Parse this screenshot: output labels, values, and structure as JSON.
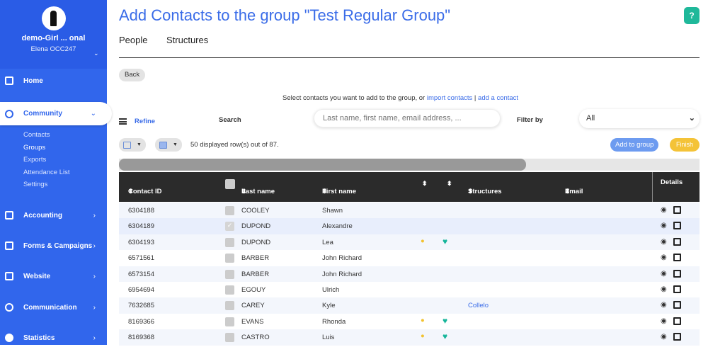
{
  "sidebar": {
    "org": "demo-Girl ... onal",
    "user": "Elena OCC247",
    "items": [
      {
        "label": "Home"
      },
      {
        "label": "Community"
      },
      {
        "label": "Accounting"
      },
      {
        "label": "Forms & Campaigns"
      },
      {
        "label": "Website"
      },
      {
        "label": "Communication"
      },
      {
        "label": "Statistics"
      }
    ],
    "sub": [
      "Contacts",
      "Groups",
      "Exports",
      "Attendance List",
      "Settings"
    ]
  },
  "header": {
    "title": "Add Contacts to the group \"Test Regular Group\"",
    "help": "?",
    "tabs": [
      "People",
      "Structures"
    ]
  },
  "toolbar": {
    "back": "Back",
    "hint": "Select contacts you want to add to the group, or",
    "import": "import contacts",
    "sep": " | ",
    "add_contact": "add a contact",
    "refine": "Refine",
    "search_label": "Search",
    "search_placeholder": "Last name, first name, email address, ...",
    "filter_label": "Filter by",
    "filter_value": "All",
    "count": "50 displayed row(s) out of 87.",
    "add_to_group": "Add to group",
    "finish": "Finish"
  },
  "table": {
    "headers": [
      "Contact ID",
      "Last name",
      "First name",
      "Structures",
      "Email",
      "Details"
    ],
    "rows": [
      {
        "id": "6304188",
        "last": "COOLEY",
        "first": "Shawn",
        "bulb": false,
        "heart": false,
        "structure": "",
        "checked": false
      },
      {
        "id": "6304189",
        "last": "DUPOND",
        "first": "Alexandre",
        "bulb": false,
        "heart": false,
        "structure": "",
        "checked": true
      },
      {
        "id": "6304193",
        "last": "DUPOND",
        "first": "Lea",
        "bulb": true,
        "heart": true,
        "structure": "",
        "checked": false
      },
      {
        "id": "6571561",
        "last": "BARBER",
        "first": "John Richard",
        "bulb": false,
        "heart": false,
        "structure": "",
        "checked": false
      },
      {
        "id": "6573154",
        "last": "BARBER",
        "first": "John Richard",
        "bulb": false,
        "heart": false,
        "structure": "",
        "checked": false
      },
      {
        "id": "6954694",
        "last": "EGOUY",
        "first": "Ulrich",
        "bulb": false,
        "heart": false,
        "structure": "",
        "checked": false
      },
      {
        "id": "7632685",
        "last": "CAREY",
        "first": "Kyle",
        "bulb": false,
        "heart": false,
        "structure": "Collelo",
        "checked": false
      },
      {
        "id": "8169366",
        "last": "EVANS",
        "first": "Rhonda",
        "bulb": true,
        "heart": true,
        "structure": "",
        "checked": false
      },
      {
        "id": "8169368",
        "last": "CASTRO",
        "first": "Luis",
        "bulb": true,
        "heart": true,
        "structure": "",
        "checked": false
      }
    ]
  }
}
